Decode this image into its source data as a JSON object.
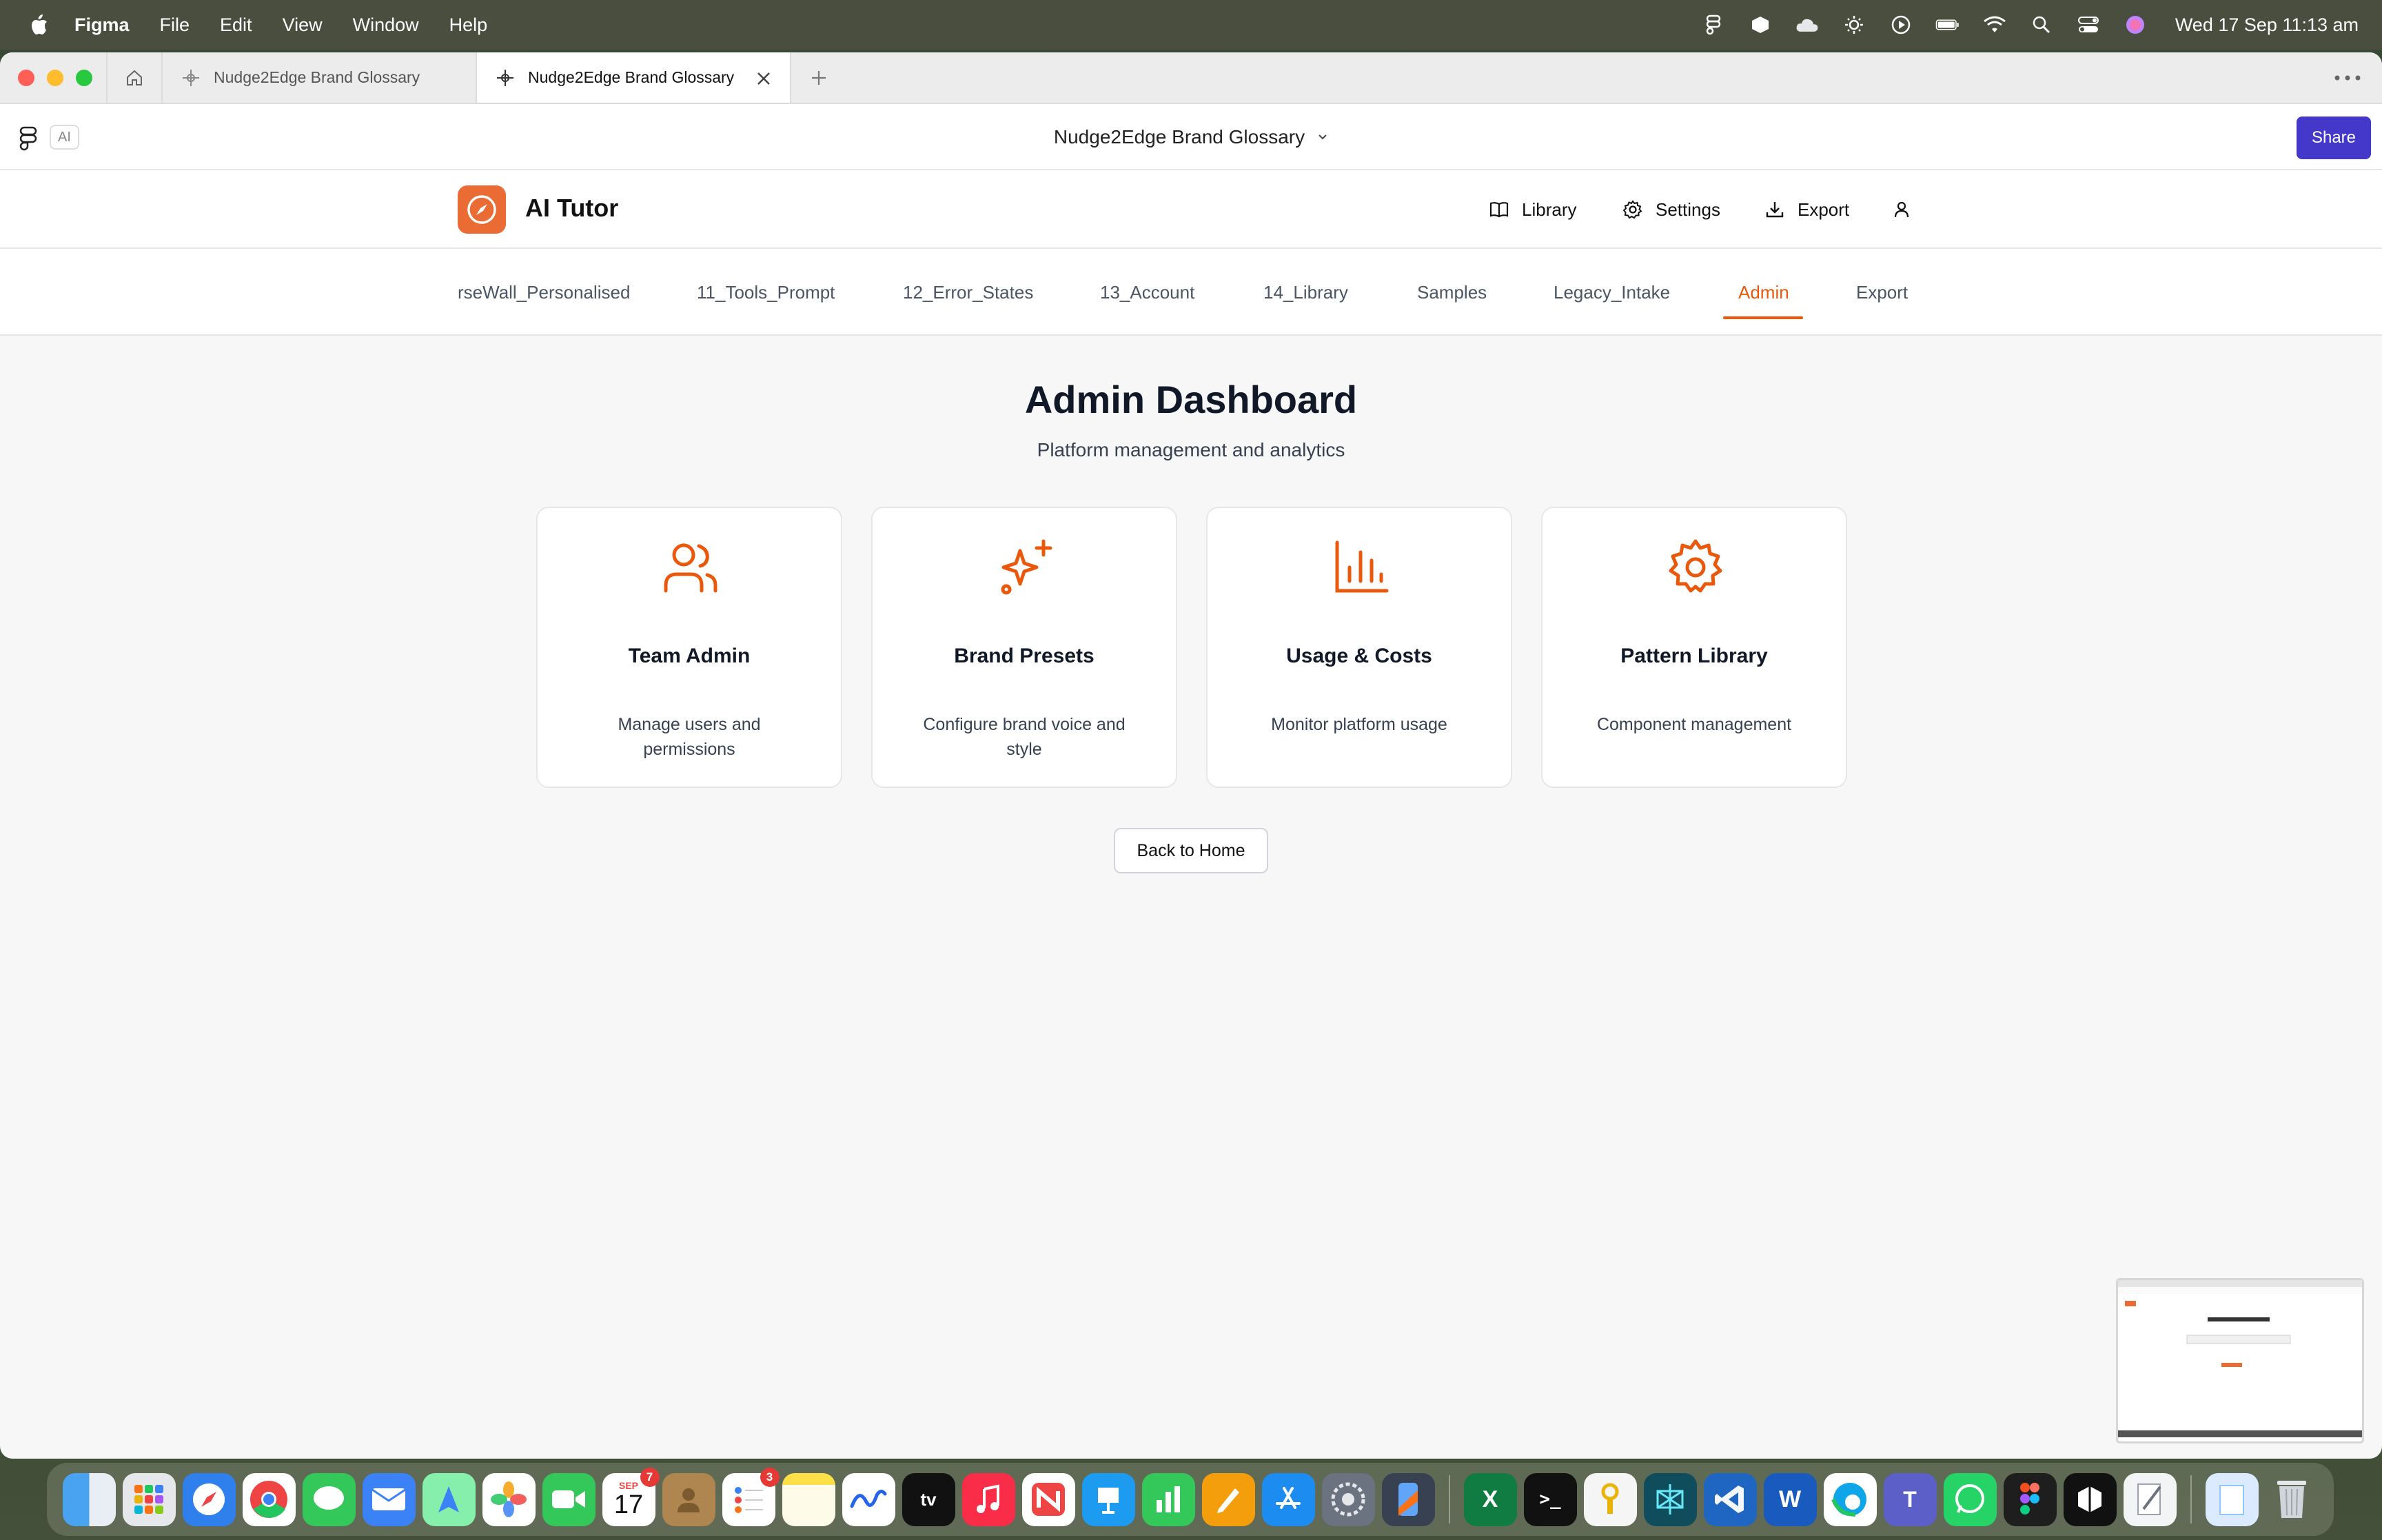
{
  "menubar": {
    "app": "Figma",
    "items": [
      "File",
      "Edit",
      "View",
      "Window",
      "Help"
    ],
    "clock": "Wed 17 Sep  11:13 am"
  },
  "tabs": {
    "tab1": "Nudge2Edge Brand Glossary",
    "tab2": "Nudge2Edge Brand Glossary"
  },
  "toolbar": {
    "ai_badge": "AI",
    "doc_title": "Nudge2Edge Brand Glossary",
    "share_label": "Share"
  },
  "app": {
    "title": "AI Tutor",
    "nav": {
      "library": "Library",
      "settings": "Settings",
      "export": "Export"
    }
  },
  "page_tabs": [
    "rseWall_Personalised",
    "11_Tools_Prompt",
    "12_Error_States",
    "13_Account",
    "14_Library",
    "Samples",
    "Legacy_Intake",
    "Admin",
    "Export"
  ],
  "active_tab": "Admin",
  "dashboard": {
    "title": "Admin Dashboard",
    "subtitle": "Platform management and analytics",
    "cards": [
      {
        "icon": "users-icon",
        "title": "Team Admin",
        "desc": "Manage users and permissions"
      },
      {
        "icon": "sparkles-icon",
        "title": "Brand Presets",
        "desc": "Configure brand voice and style"
      },
      {
        "icon": "bar-chart-icon",
        "title": "Usage & Costs",
        "desc": "Monitor platform usage"
      },
      {
        "icon": "gear-icon",
        "title": "Pattern Library",
        "desc": "Component management"
      }
    ],
    "back_label": "Back to Home"
  },
  "dock": {
    "calendar_month": "SEP",
    "calendar_day": "17",
    "calendar_badge": "7",
    "reminders_badge": "3",
    "tv_label": "tv"
  },
  "colors": {
    "accent": "#ea580c",
    "share": "#4338ca",
    "logo": "#ea6b33"
  }
}
